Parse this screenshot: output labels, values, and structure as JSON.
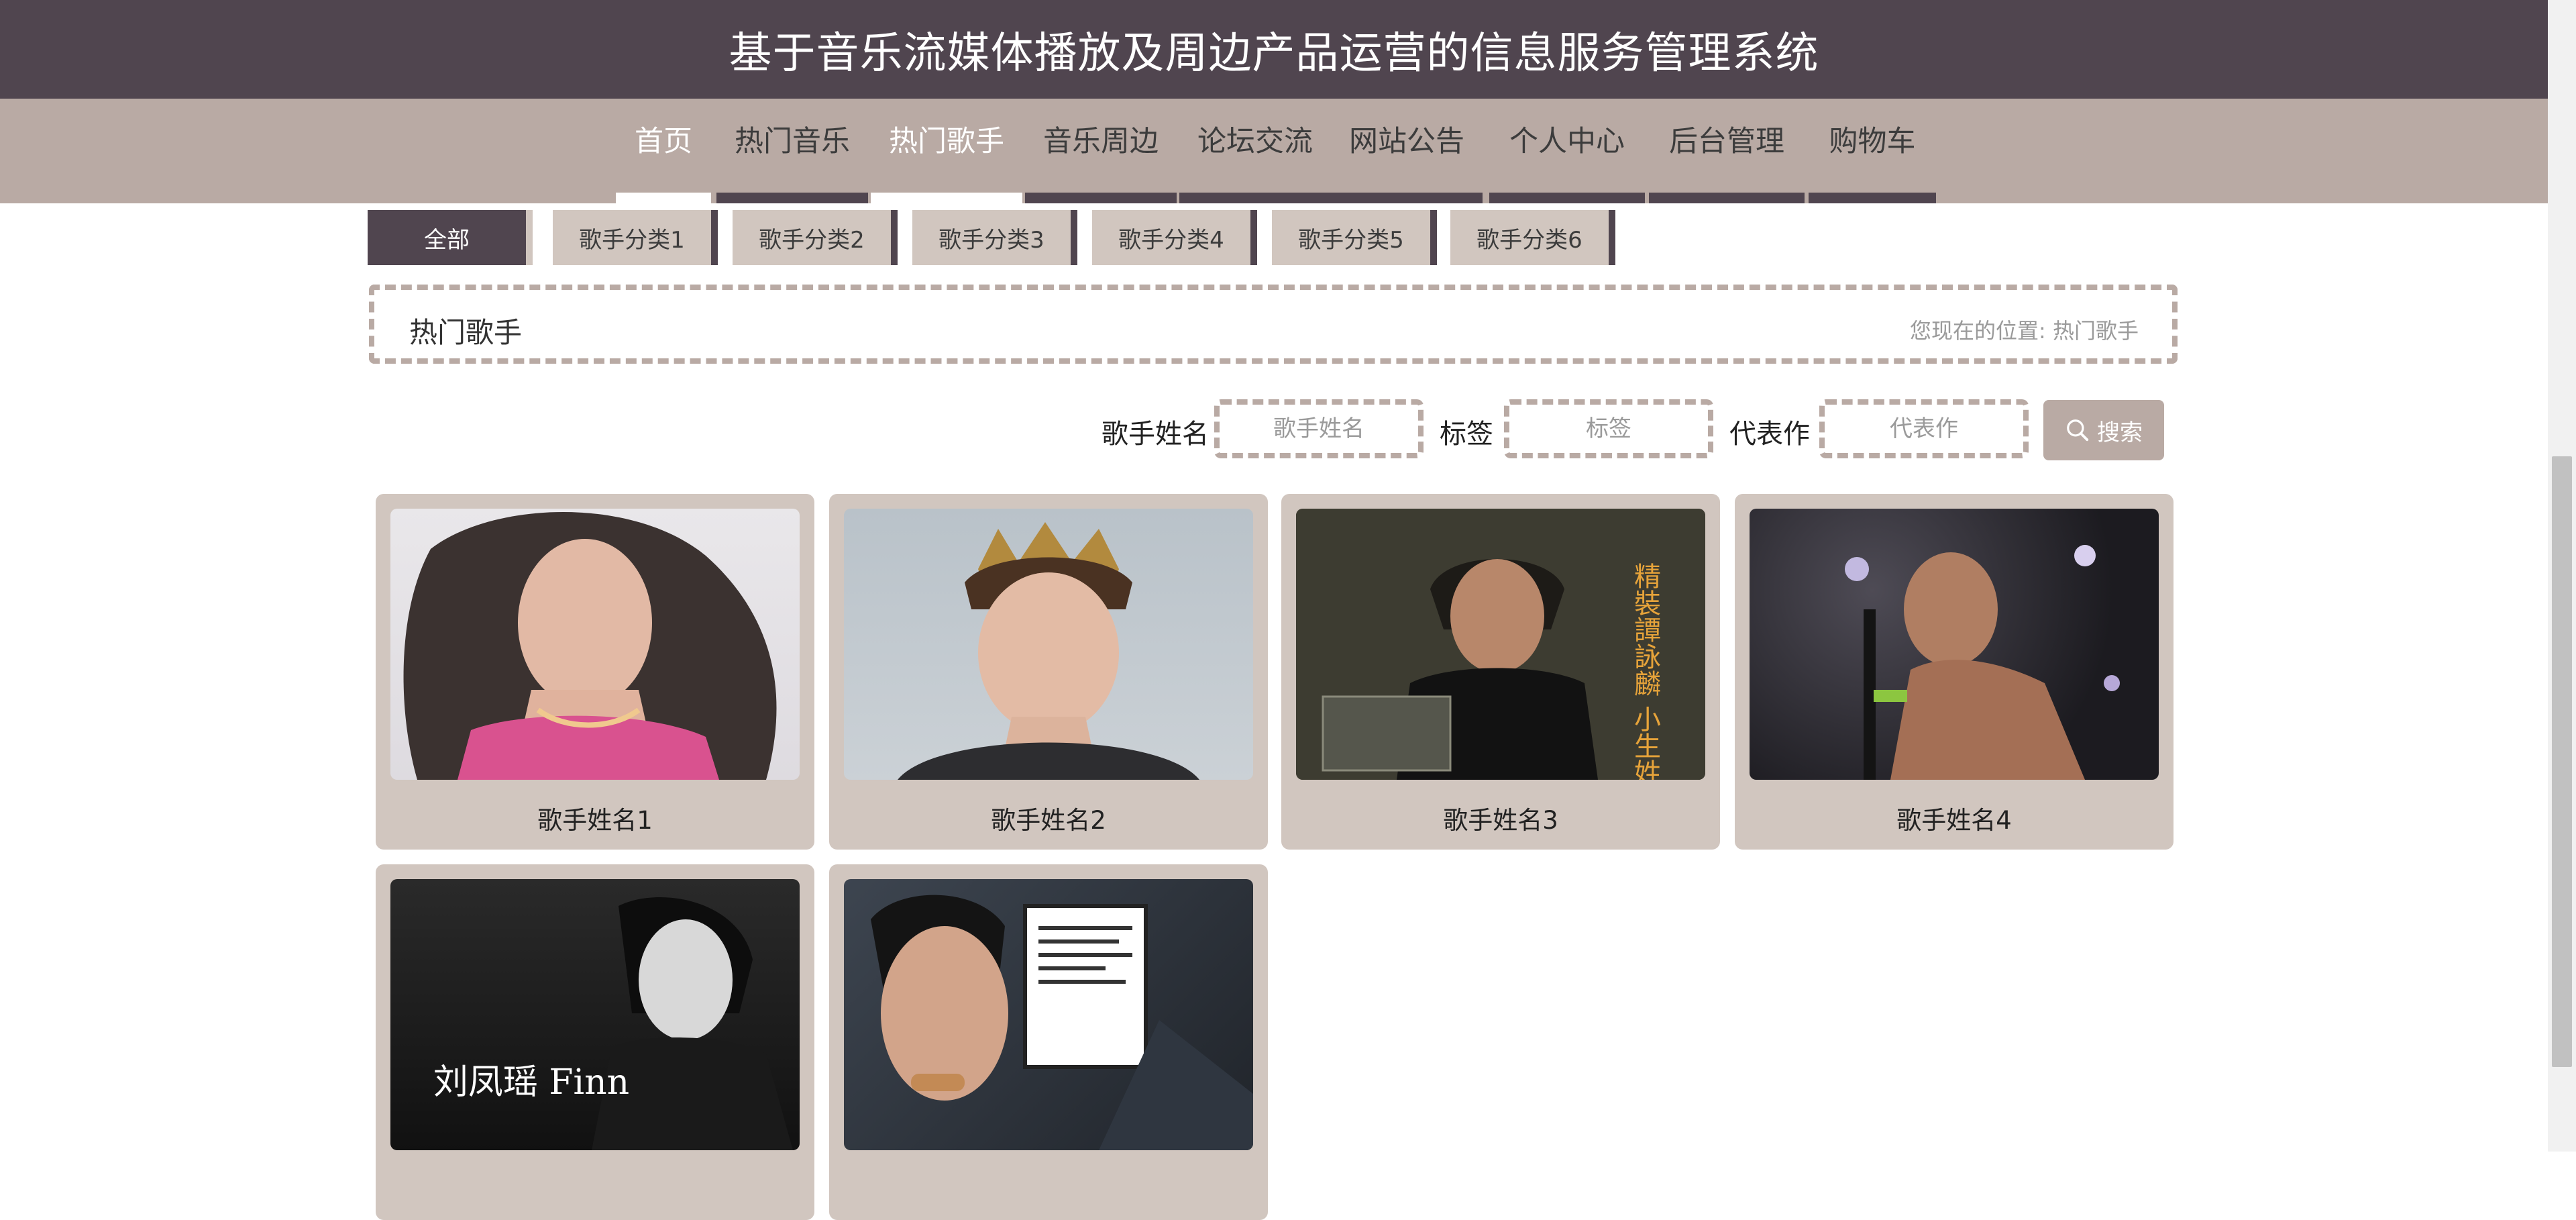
{
  "header": {
    "title": "基于音乐流媒体播放及周边产品运营的信息服务管理系统"
  },
  "nav": {
    "items": [
      "首页",
      "热门音乐",
      "热门歌手",
      "音乐周边",
      "论坛交流",
      "网站公告",
      "个人中心",
      "后台管理",
      "购物车"
    ]
  },
  "categories": [
    "全部",
    "歌手分类1",
    "歌手分类2",
    "歌手分类3",
    "歌手分类4",
    "歌手分类5",
    "歌手分类6"
  ],
  "breadcrumb": {
    "heading": "热门歌手",
    "location_prefix": "您现在的位置:",
    "location": "热门歌手"
  },
  "search": {
    "name_label": "歌手姓名",
    "name_placeholder": "歌手姓名",
    "tag_label": "标签",
    "tag_placeholder": "标签",
    "work_label": "代表作",
    "work_placeholder": "代表作",
    "button_label": "搜索"
  },
  "singers": [
    {
      "name": "歌手姓名1"
    },
    {
      "name": "歌手姓名2"
    },
    {
      "name": "歌手姓名3",
      "cover_text": "精裝譚詠麟 小生姓譚"
    },
    {
      "name": "歌手姓名4"
    },
    {
      "name": "",
      "cover_text": "刘凤瑶 Finn"
    },
    {
      "name": ""
    }
  ],
  "colors": {
    "header_bg": "#50454f",
    "nav_bg": "#b9aaa4",
    "card_bg": "#d1c6bf"
  }
}
